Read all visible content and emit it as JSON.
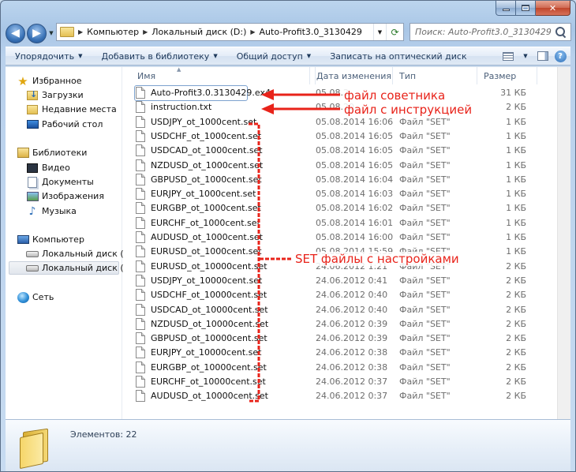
{
  "window": {
    "caption_max": "",
    "caption_close": "✕"
  },
  "navbar": {
    "breadcrumb": [
      "Компьютер",
      "Локальный диск (D:)",
      "Auto-Profit3.0_3130429"
    ],
    "search_placeholder": "Поиск: Auto-Profit3.0_3130429"
  },
  "toolbar": {
    "organize": "Упорядочить",
    "add_to_library": "Добавить в библиотеку",
    "share": "Общий доступ",
    "burn": "Записать на оптический диск"
  },
  "sidebar": {
    "favorites": "Избранное",
    "downloads": "Загрузки",
    "recent": "Недавние места",
    "desktop": "Рабочий стол",
    "libraries": "Библиотеки",
    "video": "Видео",
    "documents": "Документы",
    "pictures": "Изображения",
    "music": "Музыка",
    "computer": "Компьютер",
    "disk_c": "Локальный диск (C:)",
    "disk_d": "Локальный диск (D:)",
    "network": "Сеть"
  },
  "columns": {
    "name": "Имя",
    "date": "Дата изменения",
    "type": "Тип",
    "size": "Размер"
  },
  "files": [
    {
      "name": "Auto-Profit3.0.3130429.ex4",
      "date": "05.08.2",
      "type": "",
      "size": "31 КБ"
    },
    {
      "name": "instruction.txt",
      "date": "05.08.20",
      "type": "",
      "size": "2 КБ"
    },
    {
      "name": "USDJPY_ot_1000cent.set",
      "date": "05.08.2014 16:06",
      "type": "Файл \"SET\"",
      "size": "1 КБ"
    },
    {
      "name": "USDCHF_ot_1000cent.set",
      "date": "05.08.2014 16:05",
      "type": "Файл \"SET\"",
      "size": "1 КБ"
    },
    {
      "name": "USDCAD_ot_1000cent.set",
      "date": "05.08.2014 16:05",
      "type": "Файл \"SET\"",
      "size": "1 КБ"
    },
    {
      "name": "NZDUSD_ot_1000cent.set",
      "date": "05.08.2014 16:05",
      "type": "Файл \"SET\"",
      "size": "1 КБ"
    },
    {
      "name": "GBPUSD_ot_1000cent.set",
      "date": "05.08.2014 16:04",
      "type": "Файл \"SET\"",
      "size": "1 КБ"
    },
    {
      "name": "EURJPY_ot_1000cent.set",
      "date": "05.08.2014 16:03",
      "type": "Файл \"SET\"",
      "size": "1 КБ"
    },
    {
      "name": "EURGBP_ot_1000cent.set",
      "date": "05.08.2014 16:02",
      "type": "Файл \"SET\"",
      "size": "1 КБ"
    },
    {
      "name": "EURCHF_ot_1000cent.set",
      "date": "05.08.2014 16:01",
      "type": "Файл \"SET\"",
      "size": "1 КБ"
    },
    {
      "name": "AUDUSD_ot_1000cent.set",
      "date": "05.08.2014 16:00",
      "type": "Файл \"SET\"",
      "size": "1 КБ"
    },
    {
      "name": "EURUSD_ot_1000cent.set",
      "date": "05.08.2014 15:59",
      "type": "Файл \"SET\"",
      "size": "1 КБ"
    },
    {
      "name": "EURUSD_ot_10000cent.set",
      "date": "24.06.2012 1:21",
      "type": "Файл \"SET\"",
      "size": "2 КБ"
    },
    {
      "name": "USDJPY_ot_10000cent.set",
      "date": "24.06.2012 0:41",
      "type": "Файл \"SET\"",
      "size": "2 КБ"
    },
    {
      "name": "USDCHF_ot_10000cent.set",
      "date": "24.06.2012 0:40",
      "type": "Файл \"SET\"",
      "size": "2 КБ"
    },
    {
      "name": "USDCAD_ot_10000cent.set",
      "date": "24.06.2012 0:40",
      "type": "Файл \"SET\"",
      "size": "2 КБ"
    },
    {
      "name": "NZDUSD_ot_10000cent.set",
      "date": "24.06.2012 0:39",
      "type": "Файл \"SET\"",
      "size": "2 КБ"
    },
    {
      "name": "GBPUSD_ot_10000cent.set",
      "date": "24.06.2012 0:39",
      "type": "Файл \"SET\"",
      "size": "2 КБ"
    },
    {
      "name": "EURJPY_ot_10000cent.set",
      "date": "24.06.2012 0:38",
      "type": "Файл \"SET\"",
      "size": "2 КБ"
    },
    {
      "name": "EURGBP_ot_10000cent.set",
      "date": "24.06.2012 0:38",
      "type": "Файл \"SET\"",
      "size": "2 КБ"
    },
    {
      "name": "EURCHF_ot_10000cent.set",
      "date": "24.06.2012 0:37",
      "type": "Файл \"SET\"",
      "size": "2 КБ"
    },
    {
      "name": "AUDUSD_ot_10000cent.set",
      "date": "24.06.2012 0:37",
      "type": "Файл \"SET\"",
      "size": "2 КБ"
    }
  ],
  "annotations": {
    "advisor_file": "файл советника",
    "instructions_file": "файл с инструкцией",
    "set_files": "SET файлы с настройками",
    "color": "#e8231a"
  },
  "details": {
    "count": "Элементов: 22"
  }
}
